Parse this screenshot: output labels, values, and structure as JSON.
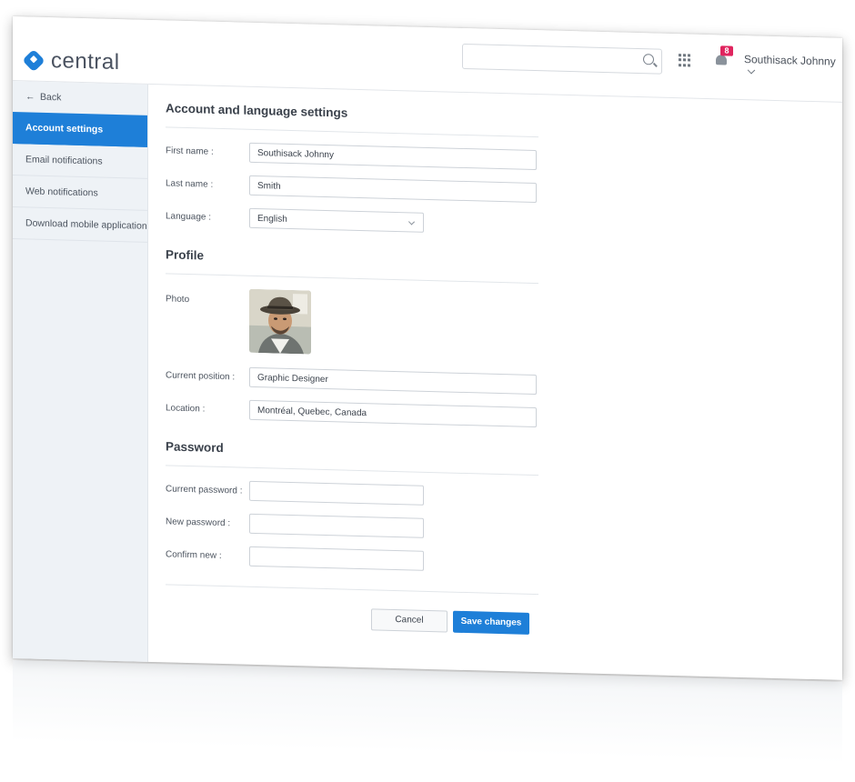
{
  "app": {
    "logo_text": "central",
    "brand_color": "#1e7fd8"
  },
  "header": {
    "search_placeholder": "",
    "notification_count": "8",
    "user_name": "Southisack Johnny"
  },
  "sidebar": {
    "back_label": "Back",
    "items": [
      {
        "label": "Account settings",
        "active": true
      },
      {
        "label": "Email notifications",
        "active": false
      },
      {
        "label": "Web notifications",
        "active": false
      },
      {
        "label": "Download mobile application",
        "active": false
      }
    ]
  },
  "account": {
    "title": "Account and language settings",
    "first_name_label": "First name :",
    "first_name_value": "Southisack Johnny",
    "last_name_label": "Last name :",
    "last_name_value": "Smith",
    "language_label": "Language :",
    "language_value": "English"
  },
  "profile": {
    "title": "Profile",
    "photo_label": "Photo",
    "position_label": "Current position :",
    "position_value": "Graphic Designer",
    "location_label": "Location :",
    "location_value": "Montréal, Quebec, Canada"
  },
  "password": {
    "title": "Password",
    "current_label": "Current password :",
    "current_value": "",
    "new_label": "New password :",
    "new_value": "",
    "confirm_label": "Confirm new :",
    "confirm_value": ""
  },
  "actions": {
    "cancel_label": "Cancel",
    "save_label": "Save changes"
  }
}
